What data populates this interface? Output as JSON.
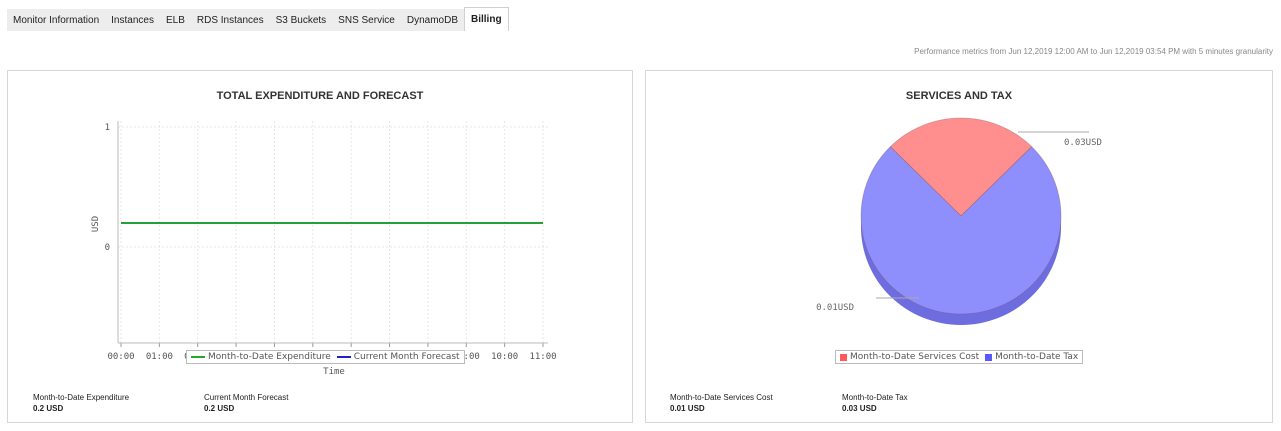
{
  "tabs": [
    {
      "label": "Monitor Information",
      "active": false
    },
    {
      "label": "Instances",
      "active": false
    },
    {
      "label": "ELB",
      "active": false
    },
    {
      "label": "RDS Instances",
      "active": false
    },
    {
      "label": "S3 Buckets",
      "active": false
    },
    {
      "label": "SNS Service",
      "active": false
    },
    {
      "label": "DynamoDB",
      "active": false
    },
    {
      "label": "Billing",
      "active": true
    }
  ],
  "metrics_text": "Performance metrics from Jun 12,2019 12:00 AM to Jun 12,2019 03:54 PM with 5 minutes granularity",
  "left_panel": {
    "title": "TOTAL EXPENDITURE AND FORECAST",
    "legend": [
      "Month-to-Date Expenditure",
      "Current Month Forecast"
    ],
    "summary": [
      {
        "label": "Month-to-Date Expenditure",
        "value": "0.2 USD"
      },
      {
        "label": "Current Month Forecast",
        "value": "0.2 USD"
      }
    ]
  },
  "right_panel": {
    "title": "SERVICES AND TAX",
    "legend": [
      "Month-to-Date Services Cost",
      "Month-to-Date Tax"
    ],
    "summary": [
      {
        "label": "Month-to-Date Services Cost",
        "value": "0.01 USD"
      },
      {
        "label": "Month-to-Date Tax",
        "value": "0.03 USD"
      }
    ]
  },
  "chart_data": [
    {
      "type": "line",
      "title": "TOTAL EXPENDITURE AND FORECAST",
      "xlabel": "Time",
      "ylabel": "USD",
      "x_ticks": [
        "00:00",
        "01:00",
        "02:00",
        "03:00",
        "04:00",
        "05:00",
        "06:00",
        "07:00",
        "08:00",
        "09:00",
        "10:00",
        "11:00"
      ],
      "y_ticks": [
        "1",
        "0"
      ],
      "ylim": [
        -0.8,
        1.05
      ],
      "series": [
        {
          "name": "Month-to-Date Expenditure",
          "color": "#22aa22",
          "x_start": "00:00",
          "x_end": "11:00",
          "value": 0.2
        },
        {
          "name": "Current Month Forecast",
          "color": "#2222cc",
          "x_start": "00:00",
          "x_end": "11:00",
          "value": 0.2
        }
      ],
      "grid": true,
      "legend_position": "bottom"
    },
    {
      "type": "pie",
      "title": "SERVICES AND TAX",
      "slices": [
        {
          "name": "Month-to-Date Services Cost",
          "value": 0.01,
          "label": "0.01USD",
          "color": "#ff8e8e"
        },
        {
          "name": "Month-to-Date Tax",
          "value": 0.03,
          "label": "0.03USD",
          "color": "#8e8efc"
        }
      ],
      "legend_position": "bottom"
    }
  ]
}
